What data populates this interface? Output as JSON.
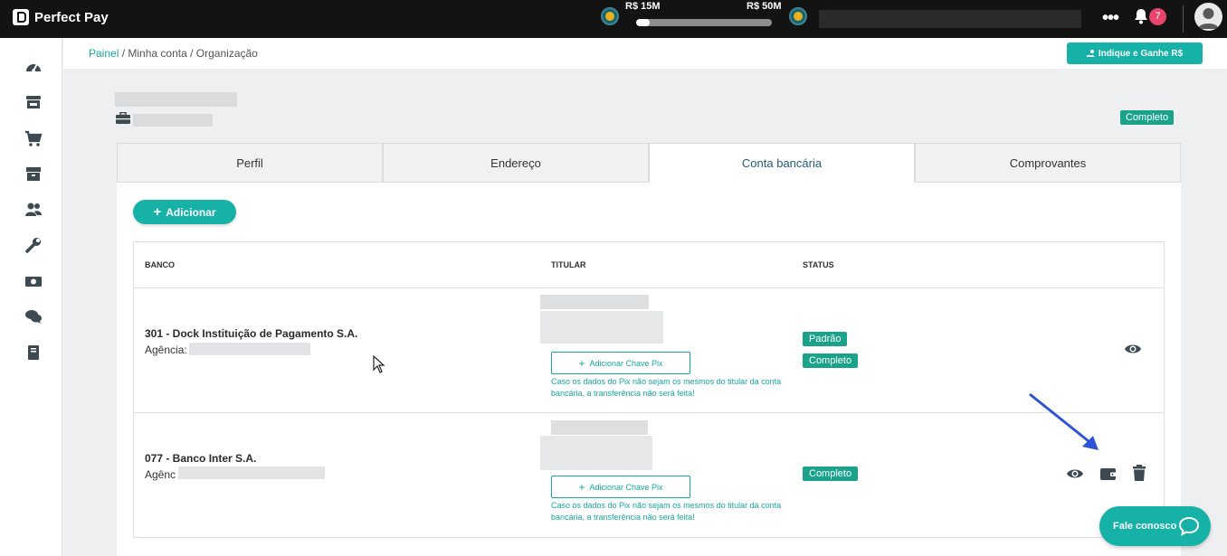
{
  "app": {
    "name": "Perfect Pay"
  },
  "topbar": {
    "goal_start_label": "R$ 15M",
    "goal_end_label": "R$ 50M",
    "goal_progress_fraction": 0.1,
    "notifications_count": "7"
  },
  "sidebar": {
    "items": [
      {
        "icon": "dashboard-gauge-icon"
      },
      {
        "icon": "store-icon"
      },
      {
        "icon": "shopping-cart-icon"
      },
      {
        "icon": "box-icon"
      },
      {
        "icon": "users-icon"
      },
      {
        "icon": "wrench-icon"
      },
      {
        "icon": "money-icon"
      },
      {
        "icon": "chat-bubbles-icon"
      },
      {
        "icon": "book-icon"
      }
    ]
  },
  "breadcrumb": {
    "items": [
      "Painel",
      "Minha conta",
      "Organização"
    ],
    "separator": "/"
  },
  "header": {
    "refer_button": "Indique e Ganhe R$",
    "status_badge": "Completo"
  },
  "tabs": [
    {
      "label": "Perfil",
      "active": false
    },
    {
      "label": "Endereço",
      "active": false
    },
    {
      "label": "Conta bancária",
      "active": true
    },
    {
      "label": "Comprovantes",
      "active": false
    }
  ],
  "add_button": "Adicionar",
  "table": {
    "headers": {
      "bank": "BANCO",
      "holder": "TITULAR",
      "status": "STATUS"
    },
    "rows": [
      {
        "bank": "301 - Dock Instituição de Pagamento S.A.",
        "agency_label": "Agência:",
        "pix_button": "Adicionar Chave Pix",
        "pix_note": "Caso os dados do Pix não sejam os mesmos do titular da conta bancária, a transferência não será feita!",
        "status": [
          "Padrão",
          "Completo"
        ],
        "actions": [
          "eye-icon"
        ]
      },
      {
        "bank": "077 - Banco Inter S.A.",
        "agency_label": "Agênc",
        "pix_button": "Adicionar Chave Pix",
        "pix_note": "Caso os dados do Pix não sejam os mesmos do titular da conta bancária, a transferência não será feita!",
        "status": [
          "Completo"
        ],
        "actions": [
          "eye-icon",
          "wallet-icon",
          "trash-icon"
        ]
      }
    ]
  },
  "chat": {
    "label": "Fale conosco"
  },
  "colors": {
    "accent": "#16b1a7",
    "badge_green": "#1aa38a",
    "topbar": "#131313"
  }
}
